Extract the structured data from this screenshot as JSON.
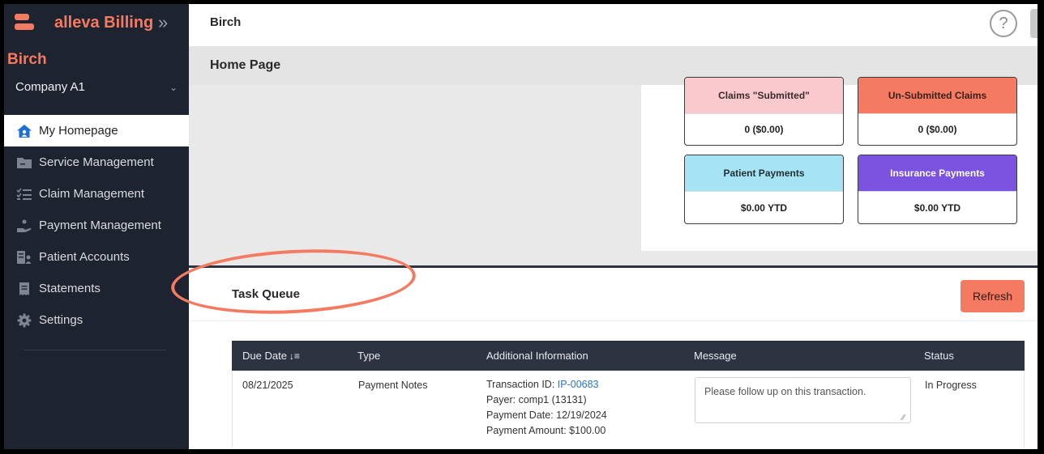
{
  "app": {
    "name": "alleva Billing",
    "collapse_glyph": "»"
  },
  "org": {
    "name": "Birch",
    "company": "Company A1"
  },
  "nav": [
    {
      "label": "My Homepage",
      "icon": "home-icon",
      "active": true
    },
    {
      "label": "Service Management",
      "icon": "folder-icon",
      "active": false
    },
    {
      "label": "Claim Management",
      "icon": "checklist-icon",
      "active": false
    },
    {
      "label": "Payment Management",
      "icon": "hand-coin-icon",
      "active": false
    },
    {
      "label": "Patient Accounts",
      "icon": "id-card-icon",
      "active": false
    },
    {
      "label": "Statements",
      "icon": "receipt-icon",
      "active": false
    },
    {
      "label": "Settings",
      "icon": "gear-icon",
      "active": false
    }
  ],
  "topbar": {
    "title": "Birch",
    "help": "?"
  },
  "page": {
    "title": "Home Page"
  },
  "cards": [
    {
      "title": "Claims \"Submitted\"",
      "value": "0 ($0.00)",
      "color": "#f9c9cd"
    },
    {
      "title": "Un-Submitted Claims",
      "value": "0 ($0.00)",
      "color": "#f47a61"
    },
    {
      "title": "Patient Payments",
      "value": "$0.00 YTD",
      "color": "#a6e3f4"
    },
    {
      "title": "Insurance Payments",
      "value": "$0.00 YTD",
      "color": "#7b53e0"
    }
  ],
  "task_queue": {
    "title": "Task Queue",
    "refresh_label": "Refresh",
    "columns": [
      "Due Date",
      "Type",
      "Additional Information",
      "Message",
      "Status"
    ],
    "sort_glyph": "↓̅",
    "rows": [
      {
        "due_date": "08/21/2025",
        "type": "Payment Notes",
        "txn_label": "Transaction ID: ",
        "txn_id": "IP-00683",
        "payer": "Payer: comp1 (13131)",
        "payment_date": "Payment Date: 12/19/2024",
        "payment_amount": "Payment Amount: $100.00",
        "message": "Please follow up on this transaction.",
        "status": "In Progress"
      }
    ]
  },
  "colors": {
    "accent": "#f47a61",
    "sidebar": "#1e2330",
    "table_header": "#2e3342",
    "link": "#2a73c9"
  }
}
